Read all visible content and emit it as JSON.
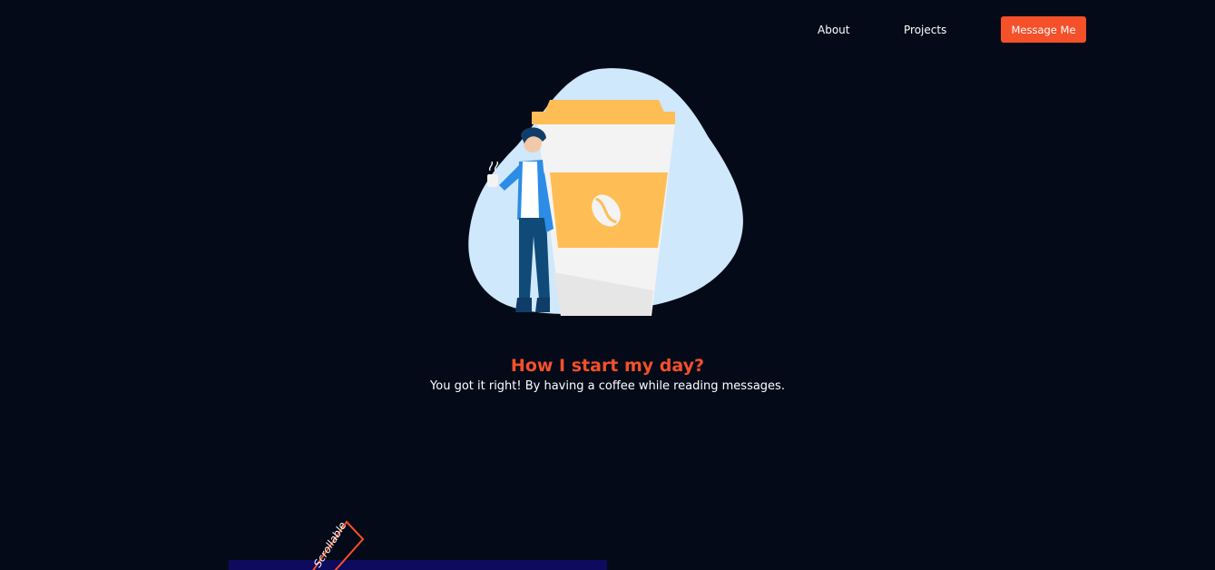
{
  "nav": {
    "about_label": "About",
    "projects_label": "Projects",
    "message_label": "Message Me"
  },
  "hero": {
    "headline": "How I start my day?",
    "subline": "You got it right! By having a coffee while reading messages."
  },
  "scroll_tag": {
    "label": "Scrollable"
  },
  "colors": {
    "background": "#050a18",
    "accent": "#f4502a",
    "blob": "#cfe8fb",
    "cup_lid": "#ffbe55",
    "panel": "#0e0a5e"
  }
}
